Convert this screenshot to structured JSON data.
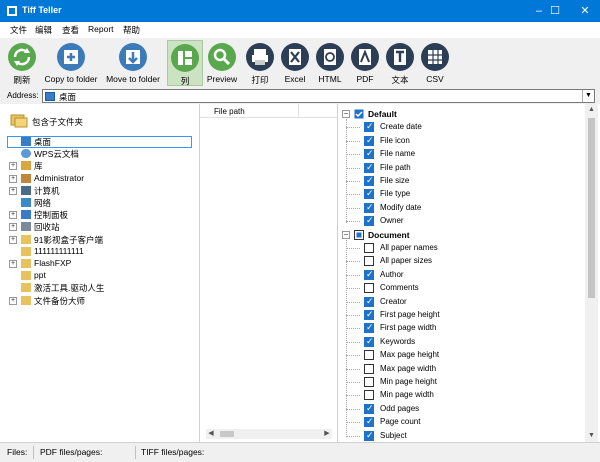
{
  "window": {
    "title": "Tiff Teller"
  },
  "window_controls": {
    "minimize": "–",
    "maximize": "☐",
    "close": "✕"
  },
  "menu": [
    "文件",
    "编辑",
    "查看",
    "Report",
    "帮助"
  ],
  "toolbar": {
    "refresh": "刷新",
    "copy_to_folder": "Copy to folder",
    "move_to_folder": "Move to folder",
    "columns": "列",
    "preview": "Preview",
    "print": "打印",
    "excel": "Excel",
    "html": "HTML",
    "pdf": "PDF",
    "text": "文本",
    "csv": "CSV"
  },
  "address": {
    "label": "Address:",
    "value": "桌面",
    "dropdown": "▼"
  },
  "left_pane": {
    "favorites_label": "包含子文件夹",
    "tree": [
      {
        "label": "桌面",
        "icon": "desktop-icon",
        "expand": "",
        "level": 0
      },
      {
        "label": "WPS云文档",
        "icon": "cloud-icon",
        "expand": "",
        "level": 1
      },
      {
        "label": "库",
        "icon": "library-icon",
        "expand": "+",
        "level": 1
      },
      {
        "label": "Administrator",
        "icon": "user-icon",
        "expand": "+",
        "level": 1
      },
      {
        "label": "计算机",
        "icon": "computer-icon",
        "expand": "+",
        "level": 1
      },
      {
        "label": "网络",
        "icon": "network-icon",
        "expand": "",
        "level": 1
      },
      {
        "label": "控制面板",
        "icon": "control-panel-icon",
        "expand": "+",
        "level": 1
      },
      {
        "label": "回收站",
        "icon": "recycle-bin-icon",
        "expand": "+",
        "level": 1
      },
      {
        "label": "91影视盒子客户端",
        "icon": "folder-icon",
        "expand": "+",
        "level": 1
      },
      {
        "label": "111111111111",
        "icon": "folder-icon",
        "expand": "",
        "level": 1
      },
      {
        "label": "FlashFXP",
        "icon": "folder-icon",
        "expand": "+",
        "level": 1
      },
      {
        "label": "ppt",
        "icon": "folder-icon",
        "expand": "",
        "level": 1
      },
      {
        "label": "激活工具.驱动人生",
        "icon": "folder-icon",
        "expand": "",
        "level": 1
      },
      {
        "label": "文件备份大师",
        "icon": "folder-icon",
        "expand": "+",
        "level": 1
      }
    ]
  },
  "middle_pane": {
    "column_header": "File path",
    "scroll_left": "◀",
    "scroll_right": "▶"
  },
  "right_pane": {
    "groups": [
      {
        "name": "Default",
        "state": "checked",
        "collapse": "−",
        "items": [
          {
            "label": "Create date",
            "checked": true
          },
          {
            "label": "File icon",
            "checked": true
          },
          {
            "label": "File name",
            "checked": true
          },
          {
            "label": "File path",
            "checked": true
          },
          {
            "label": "File size",
            "checked": true
          },
          {
            "label": "File type",
            "checked": true
          },
          {
            "label": "Modify date",
            "checked": true
          },
          {
            "label": "Owner",
            "checked": true
          }
        ]
      },
      {
        "name": "Document",
        "state": "partial",
        "collapse": "−",
        "items": [
          {
            "label": "All paper names",
            "checked": false
          },
          {
            "label": "All paper sizes",
            "checked": false
          },
          {
            "label": "Author",
            "checked": true
          },
          {
            "label": "Comments",
            "checked": false
          },
          {
            "label": "Creator",
            "checked": true
          },
          {
            "label": "First page height",
            "checked": true
          },
          {
            "label": "First page width",
            "checked": true
          },
          {
            "label": "Keywords",
            "checked": true
          },
          {
            "label": "Max page height",
            "checked": false
          },
          {
            "label": "Max page width",
            "checked": false
          },
          {
            "label": "Min page height",
            "checked": false
          },
          {
            "label": "Min page width",
            "checked": false
          },
          {
            "label": "Odd pages",
            "checked": true
          },
          {
            "label": "Page count",
            "checked": true
          },
          {
            "label": "Subject",
            "checked": true
          }
        ]
      }
    ],
    "scroll_up": "▲",
    "scroll_down": "▼"
  },
  "status": {
    "files": "Files:",
    "pdf": "PDF files/pages:",
    "tiff": "TIFF files/pages:"
  },
  "colors": {
    "titlebar": "#0078d7",
    "checkbox": "#1e73c8",
    "toolbar_active": "#cbe3c2"
  }
}
